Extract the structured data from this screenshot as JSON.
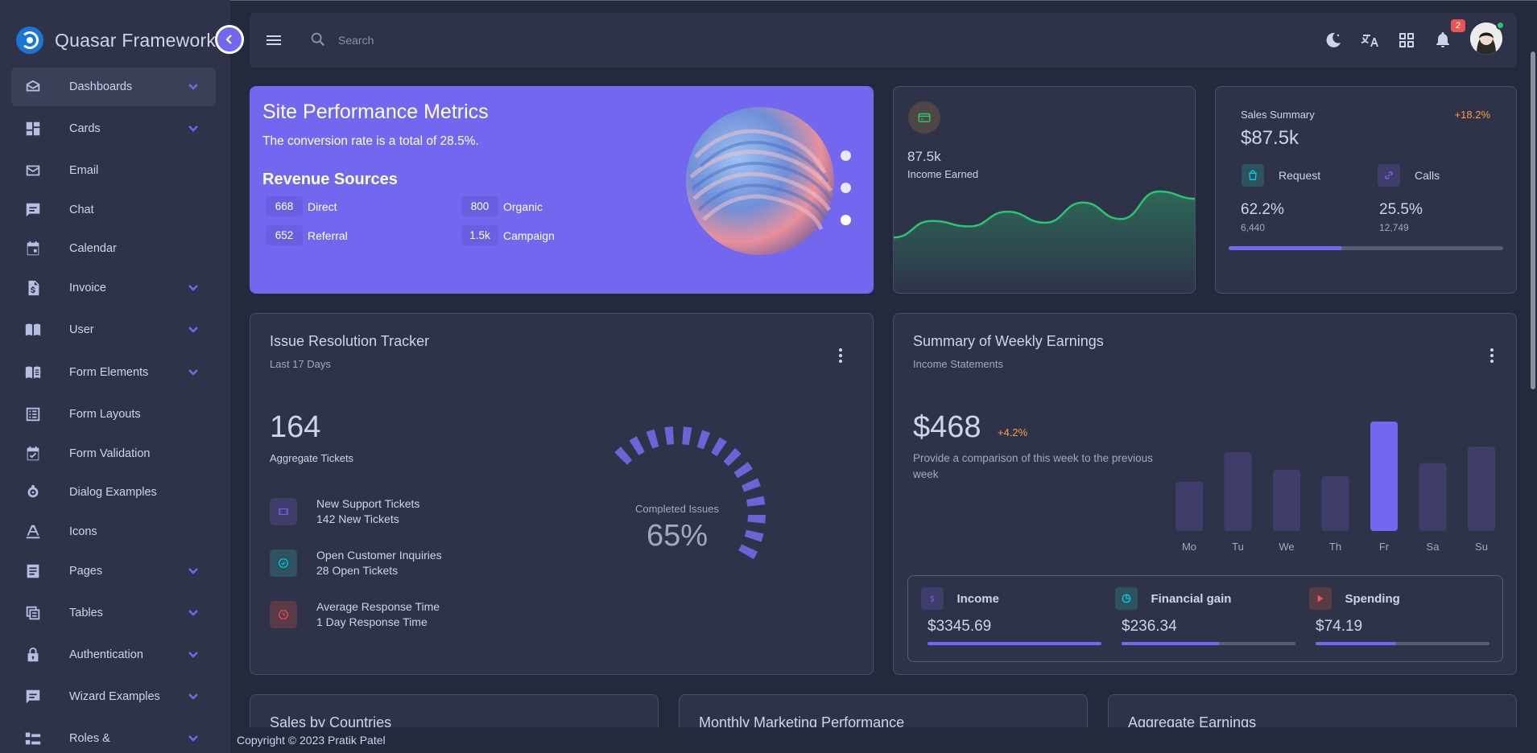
{
  "brand": {
    "name": "Quasar Framework"
  },
  "sidebar": {
    "items": [
      {
        "label": "Dashboards",
        "icon": "inbox-icon",
        "expandable": true,
        "active": true
      },
      {
        "label": "Cards",
        "icon": "dashboard-icon",
        "expandable": true
      },
      {
        "label": "Email",
        "icon": "mail-icon",
        "expandable": false
      },
      {
        "label": "Chat",
        "icon": "chat-icon",
        "expandable": false
      },
      {
        "label": "Calendar",
        "icon": "calendar-icon",
        "expandable": false
      },
      {
        "label": "Invoice",
        "icon": "invoice-icon",
        "expandable": true
      },
      {
        "label": "User",
        "icon": "user-book-icon",
        "expandable": true
      },
      {
        "label": "Form Elements",
        "icon": "form-book-icon",
        "expandable": true
      },
      {
        "label": "Form Layouts",
        "icon": "list-icon",
        "expandable": false
      },
      {
        "label": "Form Validation",
        "icon": "calendar-check-icon",
        "expandable": false
      },
      {
        "label": "Dialog Examples",
        "icon": "dialog-icon",
        "expandable": false
      },
      {
        "label": "Icons",
        "icon": "text-icon",
        "expandable": false
      },
      {
        "label": "Pages",
        "icon": "page-icon",
        "expandable": true
      },
      {
        "label": "Tables",
        "icon": "table-icon",
        "expandable": true
      },
      {
        "label": "Authentication",
        "icon": "lock-icon",
        "expandable": true
      },
      {
        "label": "Wizard Examples",
        "icon": "wizard-icon",
        "expandable": true
      },
      {
        "label": "Roles &",
        "icon": "roles-icon",
        "expandable": true
      }
    ]
  },
  "search": {
    "placeholder": "Search"
  },
  "topbar": {
    "notification_count": "2"
  },
  "hero": {
    "title": "Site Performance Metrics",
    "subtitle": "The conversion rate is a total of 28.5%.",
    "revenue_title": "Revenue Sources",
    "sources": [
      {
        "value": "668",
        "label": "Direct"
      },
      {
        "value": "800",
        "label": "Organic"
      },
      {
        "value": "652",
        "label": "Referral"
      },
      {
        "value": "1.5k",
        "label": "Campaign"
      }
    ]
  },
  "income": {
    "value": "87.5k",
    "label": "Income Earned"
  },
  "sales_summary": {
    "label": "Sales Summary",
    "change": "+18.2%",
    "value": "$87.5k",
    "request_label": "Request",
    "request_pct": "62.2%",
    "request_count": "6,440",
    "calls_label": "Calls",
    "calls_pct": "25.5%",
    "calls_count": "12,749",
    "progress": 0.41
  },
  "issue_tracker": {
    "title": "Issue Resolution Tracker",
    "subtitle": "Last 17 Days",
    "total": "164",
    "total_label": "Aggregate Tickets",
    "rows": [
      {
        "title": "New Support Tickets",
        "sub": "142 New Tickets",
        "color": "#7367f0"
      },
      {
        "title": "Open Customer Inquiries",
        "sub": "28 Open Tickets",
        "color": "#00cfe8"
      },
      {
        "title": "Average Response Time",
        "sub": "1 Day Response Time",
        "color": "#ea5455"
      }
    ],
    "gauge_label": "Completed Issues",
    "gauge_value": "65%",
    "gauge_fraction": 0.65
  },
  "weekly": {
    "title": "Summary of Weekly Earnings",
    "subtitle": "Income Statements",
    "amount": "$468",
    "change": "+4.2%",
    "description": "Provide a comparison of this week to the previous week",
    "stats": [
      {
        "label": "Income",
        "value": "$3345.69",
        "icon": "dollar-icon",
        "color": "#7367f0",
        "fill": 1.0
      },
      {
        "label": "Financial gain",
        "value": "$236.34",
        "icon": "pie-chart-icon",
        "color": "#00cfe8",
        "fill": 0.56
      },
      {
        "label": "Spending",
        "value": "$74.19",
        "icon": "brand-icon",
        "color": "#ea5455",
        "fill": 0.46
      }
    ]
  },
  "chart_data": [
    {
      "type": "area",
      "x": [
        0,
        1,
        2,
        3,
        4,
        5,
        6,
        7,
        8
      ],
      "values": [
        20,
        38,
        32,
        48,
        36,
        58,
        40,
        70,
        62
      ],
      "color": "#28c76f"
    },
    {
      "type": "bar",
      "categories": [
        "Mo",
        "Tu",
        "We",
        "Th",
        "Fr",
        "Sa",
        "Su"
      ],
      "values": [
        45,
        72,
        56,
        50,
        100,
        62,
        77
      ],
      "highlight_index": 4,
      "color": "#7367f0",
      "muted_color": "#3f3d6a"
    }
  ],
  "bottom_cards": [
    {
      "title": "Sales by Countries"
    },
    {
      "title": "Monthly Marketing Performance"
    },
    {
      "title": "Aggregate Earnings"
    }
  ],
  "footer": {
    "text": "Copyright © 2023 Pratik Patel"
  }
}
